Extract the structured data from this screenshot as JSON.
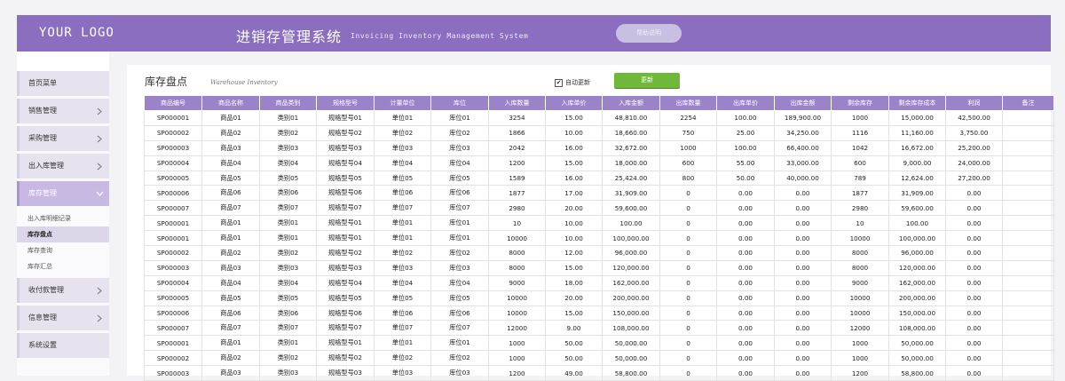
{
  "header": {
    "logo": "YOUR LOGO",
    "title": "进销存管理系统",
    "subtitle": "Invoicing Inventory Management System",
    "help_button": "帮助说明",
    "background_color": "#8b6ec0"
  },
  "sidebar": {
    "items": [
      {
        "label": "首页菜单",
        "has_chevron": false
      },
      {
        "label": "销售管理",
        "has_chevron": true
      },
      {
        "label": "采购管理",
        "has_chevron": true
      },
      {
        "label": "出入库管理",
        "has_chevron": true
      },
      {
        "label": "库存管理",
        "has_chevron": true,
        "expanded": true
      },
      {
        "label": "收付款管理",
        "has_chevron": true
      },
      {
        "label": "信息管理",
        "has_chevron": true
      },
      {
        "label": "系统设置",
        "has_chevron": false
      }
    ],
    "submenu": [
      {
        "label": "出入库明细记录"
      },
      {
        "label": "库存盘点",
        "active": true
      },
      {
        "label": "库存查询"
      },
      {
        "label": "库存汇总"
      }
    ]
  },
  "main": {
    "title": "库存盘点",
    "subtitle": "Warehouse Inventory",
    "auto_update_label": "自动更新",
    "auto_update_checked": true,
    "update_button": "更新",
    "update_button_color": "#6fb83a",
    "table": {
      "header_color": "#9a83c9",
      "columns": [
        "商品编号",
        "商品名称",
        "商品类别",
        "规格型号",
        "计量单位",
        "库位",
        "入库数量",
        "入库单价",
        "入库金额",
        "出库数量",
        "出库单价",
        "出库金额",
        "剩余库存",
        "剩余库存成本",
        "利润",
        "备注"
      ],
      "rows": [
        [
          "SP000001",
          "商品01",
          "类别01",
          "规格型号01",
          "单位01",
          "库位01",
          "3254",
          "15.00",
          "48,810.00",
          "2254",
          "100.00",
          "189,900.00",
          "1000",
          "15,000.00",
          "42,500.00",
          ""
        ],
        [
          "SP000002",
          "商品02",
          "类别02",
          "规格型号02",
          "单位02",
          "库位02",
          "1866",
          "10.00",
          "18,660.00",
          "750",
          "25.00",
          "34,250.00",
          "1116",
          "11,160.00",
          "3,750.00",
          ""
        ],
        [
          "SP000003",
          "商品03",
          "类别03",
          "规格型号03",
          "单位03",
          "库位03",
          "2042",
          "16.00",
          "32,672.00",
          "1000",
          "100.00",
          "66,400.00",
          "1042",
          "16,672.00",
          "25,200.00",
          ""
        ],
        [
          "SP000004",
          "商品04",
          "类别04",
          "规格型号04",
          "单位04",
          "库位04",
          "1200",
          "15.00",
          "18,000.00",
          "600",
          "55.00",
          "33,000.00",
          "600",
          "9,000.00",
          "24,000.00",
          ""
        ],
        [
          "SP000005",
          "商品05",
          "类别05",
          "规格型号05",
          "单位05",
          "库位05",
          "1589",
          "16.00",
          "25,424.00",
          "800",
          "50.00",
          "40,000.00",
          "789",
          "12,624.00",
          "27,200.00",
          ""
        ],
        [
          "SP000006",
          "商品06",
          "类别06",
          "规格型号06",
          "单位06",
          "库位06",
          "1877",
          "17.00",
          "31,909.00",
          "0",
          "0.00",
          "0.00",
          "1877",
          "31,909.00",
          "0.00",
          ""
        ],
        [
          "SP000007",
          "商品07",
          "类别07",
          "规格型号07",
          "单位07",
          "库位07",
          "2980",
          "20.00",
          "59,600.00",
          "0",
          "0.00",
          "0.00",
          "2980",
          "59,600.00",
          "0.00",
          ""
        ],
        [
          "SP000001",
          "商品01",
          "类别01",
          "规格型号01",
          "单位01",
          "库位01",
          "10",
          "10.00",
          "100.00",
          "0",
          "0.00",
          "0.00",
          "10",
          "100.00",
          "0.00",
          ""
        ],
        [
          "SP000001",
          "商品01",
          "类别01",
          "规格型号01",
          "单位01",
          "库位01",
          "10000",
          "10.00",
          "100,000.00",
          "0",
          "0.00",
          "0.00",
          "10000",
          "100,000.00",
          "0.00",
          ""
        ],
        [
          "SP000002",
          "商品02",
          "类别02",
          "规格型号02",
          "单位02",
          "库位02",
          "8000",
          "12.00",
          "96,000.00",
          "0",
          "0.00",
          "0.00",
          "8000",
          "96,000.00",
          "0.00",
          ""
        ],
        [
          "SP000003",
          "商品03",
          "类别03",
          "规格型号03",
          "单位03",
          "库位03",
          "8000",
          "15.00",
          "120,000.00",
          "0",
          "0.00",
          "0.00",
          "8000",
          "120,000.00",
          "0.00",
          ""
        ],
        [
          "SP000004",
          "商品04",
          "类别04",
          "规格型号04",
          "单位04",
          "库位04",
          "9000",
          "18.00",
          "162,000.00",
          "0",
          "0.00",
          "0.00",
          "9000",
          "162,000.00",
          "0.00",
          ""
        ],
        [
          "SP000005",
          "商品05",
          "类别05",
          "规格型号05",
          "单位05",
          "库位05",
          "10000",
          "20.00",
          "200,000.00",
          "0",
          "0.00",
          "0.00",
          "10000",
          "200,000.00",
          "0.00",
          ""
        ],
        [
          "SP000006",
          "商品06",
          "类别06",
          "规格型号06",
          "单位06",
          "库位06",
          "10000",
          "15.00",
          "150,000.00",
          "0",
          "0.00",
          "0.00",
          "10000",
          "150,000.00",
          "0.00",
          ""
        ],
        [
          "SP000007",
          "商品07",
          "类别07",
          "规格型号07",
          "单位07",
          "库位07",
          "12000",
          "9.00",
          "108,000.00",
          "0",
          "0.00",
          "0.00",
          "12000",
          "108,000.00",
          "0.00",
          ""
        ],
        [
          "SP000001",
          "商品01",
          "类别01",
          "规格型号01",
          "单位01",
          "库位01",
          "1000",
          "50.00",
          "50,000.00",
          "0",
          "0.00",
          "0.00",
          "1000",
          "50,000.00",
          "0.00",
          ""
        ],
        [
          "SP000002",
          "商品02",
          "类别02",
          "规格型号02",
          "单位02",
          "库位02",
          "1000",
          "50.00",
          "50,000.00",
          "0",
          "0.00",
          "0.00",
          "1000",
          "50,000.00",
          "0.00",
          ""
        ],
        [
          "SP000003",
          "商品03",
          "类别03",
          "规格型号03",
          "单位03",
          "库位03",
          "1200",
          "49.00",
          "58,800.00",
          "0",
          "0.00",
          "0.00",
          "1200",
          "58,800.00",
          "0.00",
          ""
        ]
      ]
    }
  }
}
